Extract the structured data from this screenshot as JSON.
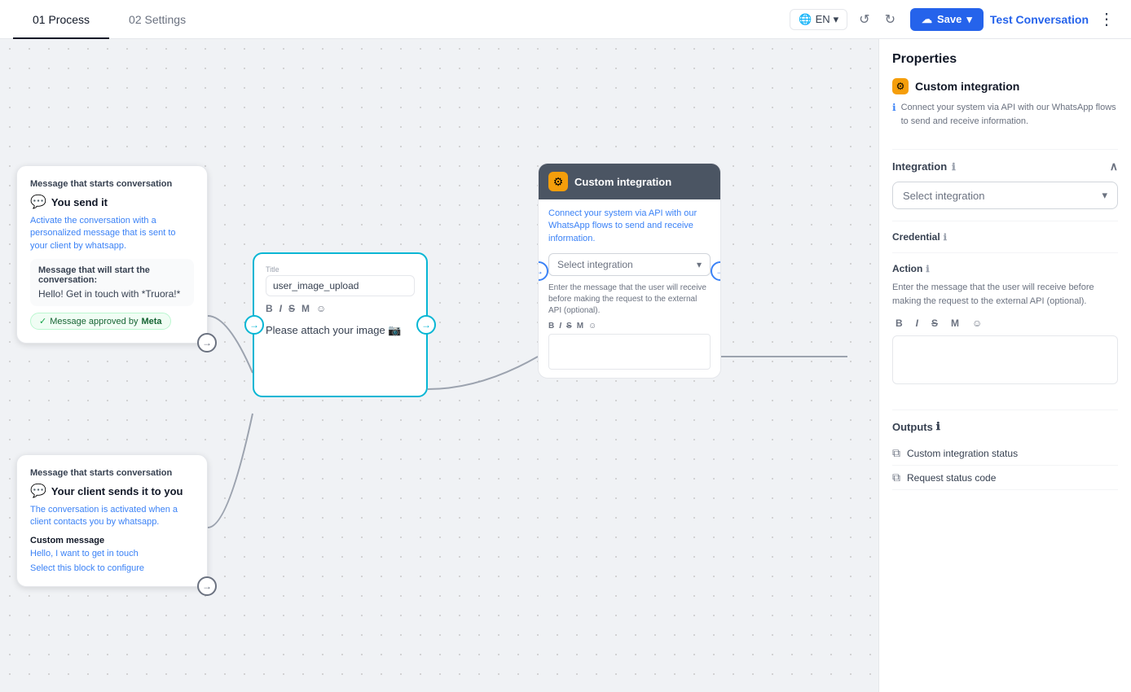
{
  "nav": {
    "tab_process": "01 Process",
    "tab_settings": "02 Settings",
    "lang": "EN",
    "save_label": "Save",
    "test_conv_label": "Test Conversation",
    "undo": "↺",
    "redo": "↻"
  },
  "canvas": {
    "card_msg_top": {
      "title": "Message that starts conversation",
      "sender": "You send it",
      "desc": "Activate the conversation with a personalized message that is sent to your client by whatsapp.",
      "message_label": "Message that will start the conversation:",
      "message_value": "Hello! Get in touch with *Truora!*",
      "approved_label": "Message approved by",
      "approved_by": "Meta"
    },
    "card_msg_bot": {
      "title": "Message that starts conversation",
      "sender": "Your client sends it to you",
      "desc": "The conversation is activated when a client contacts you by whatsapp.",
      "custom_msg_label": "Custom message",
      "custom_msg_value": "Hello, I want to get in touch",
      "select_link": "Select this block to configure"
    },
    "card_input": {
      "title_label": "Title",
      "title_value": "user_image_upload",
      "toolbar": [
        "B",
        "I",
        "S",
        "M",
        "☺"
      ],
      "content": "Please attach your image 📷"
    },
    "card_integration": {
      "header_title": "Custom integration",
      "desc": "Connect your system via API with our WhatsApp flows to send and receive information.",
      "select_placeholder": "Select integration",
      "optional_desc": "Enter the message that the user will receive before making the request to the external API (optional).",
      "toolbar": [
        "B",
        "I",
        "S",
        "M",
        "☺"
      ]
    }
  },
  "panel": {
    "title": "Properties",
    "integration_icon": "⚙",
    "integration_title": "Custom integration",
    "integration_desc": "Connect your system via API with our WhatsApp flows to send and receive information.",
    "section_integration": "Integration",
    "select_integration_placeholder": "Select integration",
    "section_credential": "Credential",
    "section_action": "Action",
    "action_desc": "Enter the message that the user will receive before making the request to the external API (optional).",
    "toolbar": [
      "B",
      "I",
      "S",
      "M",
      "☺"
    ],
    "outputs_title": "Outputs",
    "outputs": [
      {
        "label": "Custom integration status"
      },
      {
        "label": "Request status code"
      }
    ]
  }
}
